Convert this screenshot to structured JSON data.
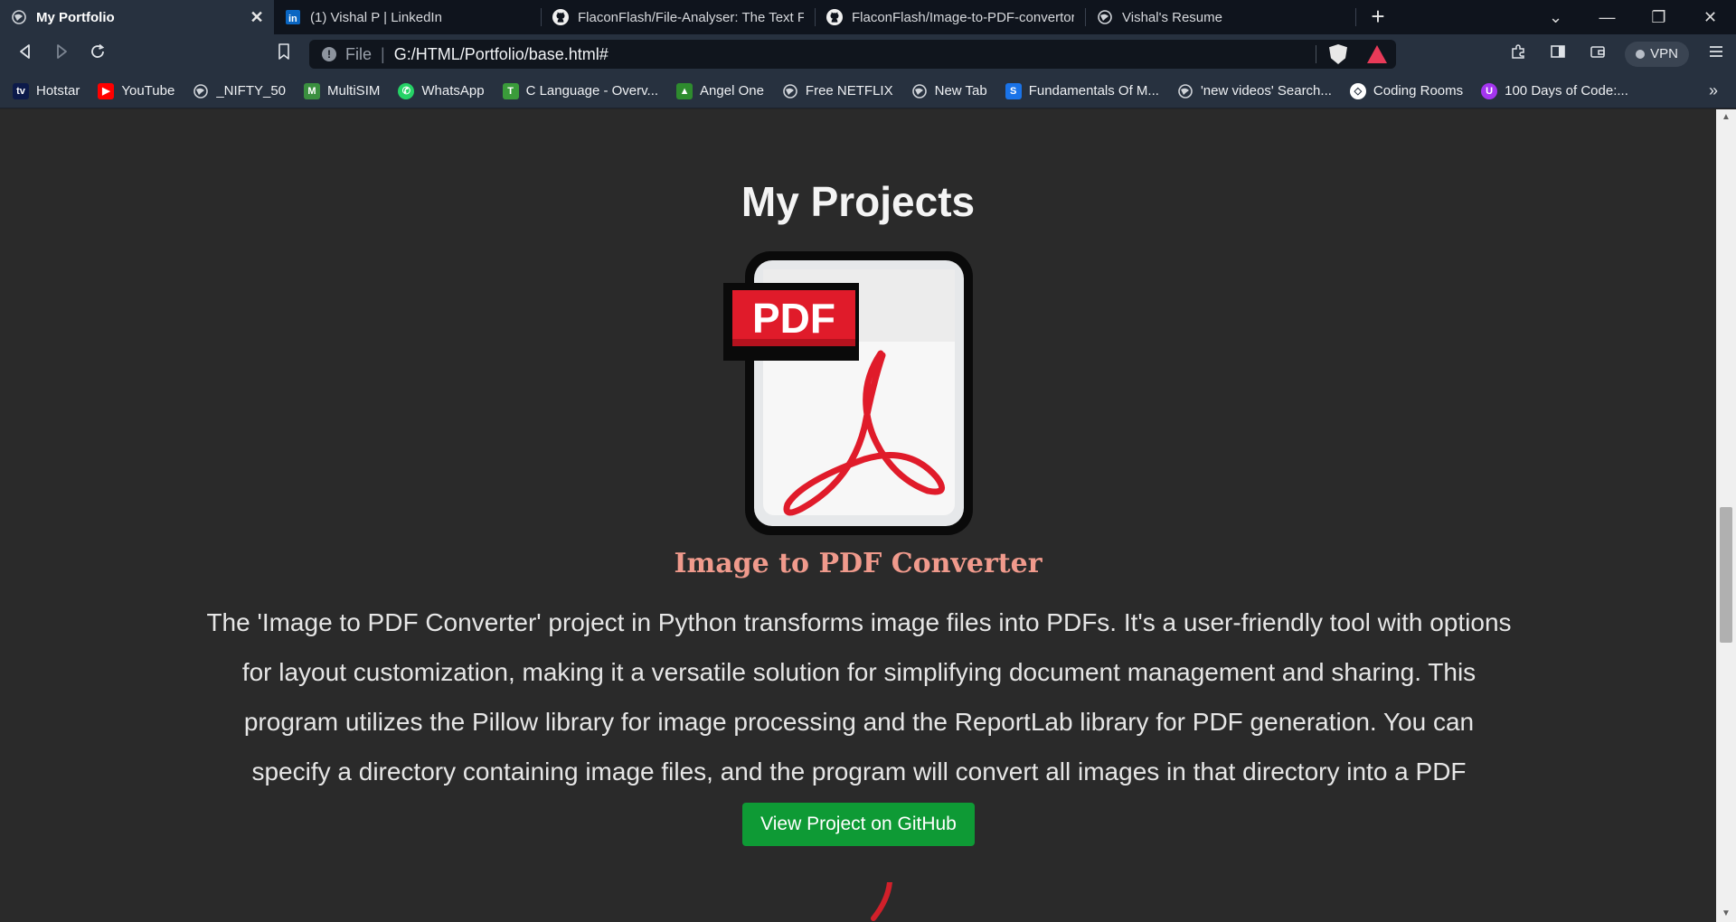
{
  "tabs": [
    {
      "title": "My Portfolio",
      "active": true,
      "icon": "globe-icon"
    },
    {
      "title": "(1) Vishal P | LinkedIn",
      "active": false,
      "icon": "linkedin-icon"
    },
    {
      "title": "FlaconFlash/File-Analyser: The Text File",
      "active": false,
      "icon": "github-icon"
    },
    {
      "title": "FlaconFlash/Image-to-PDF-convertor-",
      "active": false,
      "icon": "github-icon"
    },
    {
      "title": "Vishal's Resume",
      "active": false,
      "icon": "globe-icon"
    }
  ],
  "tab_close_glyph": "✕",
  "new_tab_glyph": "+",
  "window_controls": {
    "list": "⌄",
    "minimize": "—",
    "restore": "❐",
    "close": "✕"
  },
  "address_bar": {
    "scheme": "File",
    "url": "G:/HTML/Portfolio/base.html#"
  },
  "toolbar": {
    "vpn_label": "VPN"
  },
  "bookmarks": [
    {
      "label": "Hotstar",
      "icon": "hotstar-icon",
      "color": "#0c1a4a"
    },
    {
      "label": "YouTube",
      "icon": "youtube-icon",
      "color": "#ff0000"
    },
    {
      "label": "_NIFTY_50",
      "icon": "globe-icon",
      "color": "#6a6f78"
    },
    {
      "label": "MultiSIM",
      "icon": "multisim-icon",
      "color": "#3a8f3f"
    },
    {
      "label": "WhatsApp",
      "icon": "whatsapp-icon",
      "color": "#25d366"
    },
    {
      "label": "C Language - Overv...",
      "icon": "tutorials-icon",
      "color": "#3a9b3a"
    },
    {
      "label": "Angel One",
      "icon": "angel-one-icon",
      "color": "#2e8b2e"
    },
    {
      "label": "Free NETFLIX",
      "icon": "globe-icon",
      "color": "#6a6f78"
    },
    {
      "label": "New Tab",
      "icon": "globe-icon",
      "color": "#6a6f78"
    },
    {
      "label": "Fundamentals Of M...",
      "icon": "scaler-icon",
      "color": "#1a73e8"
    },
    {
      "label": "'new videos' Search...",
      "icon": "globe-icon",
      "color": "#6a6f78"
    },
    {
      "label": "Coding Rooms",
      "icon": "coding-rooms-icon",
      "color": "#ffffff"
    },
    {
      "label": "100 Days of Code:...",
      "icon": "udemy-icon",
      "color": "#a435f0"
    }
  ],
  "bookmarks_more_glyph": "»",
  "page": {
    "heading": "My Projects",
    "project": {
      "image_text": "PDF",
      "title": "Image to PDF Converter",
      "description": "The 'Image to PDF Converter' project in Python transforms image files into PDFs. It's a user-friendly tool with options for layout customization, making it a versatile solution for simplifying document management and sharing. This program utilizes the Pillow library for image processing and the ReportLab library for PDF generation. You can specify a directory containing image files, and the program will convert all images in that directory into a PDF document.",
      "button_label": "View Project on GitHub"
    }
  },
  "colors": {
    "page_bg": "#2a2a2a",
    "project_title": "#f09a8c",
    "button_bg": "#0e9a35",
    "pdf_red": "#e01b2a"
  }
}
